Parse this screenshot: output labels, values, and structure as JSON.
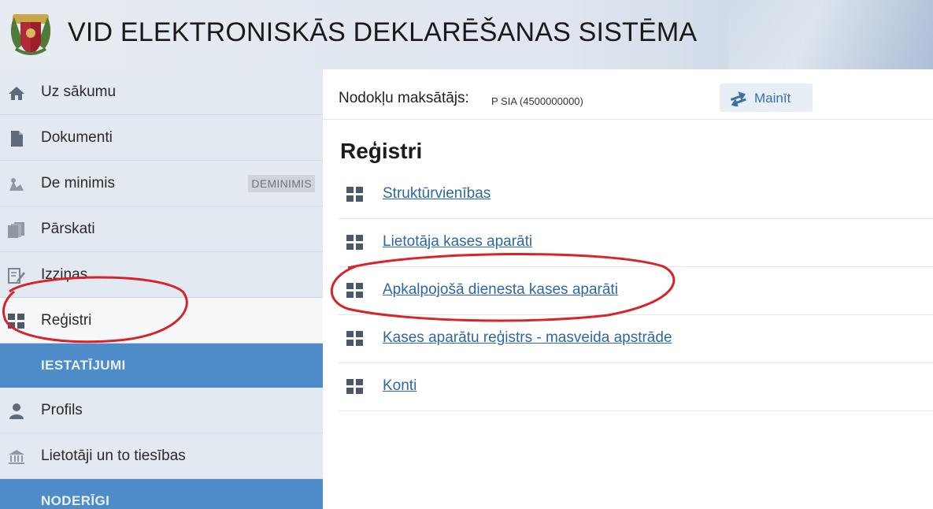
{
  "header": {
    "title": "VID ELEKTRONISKĀS DEKLARĒŠANAS SISTĒMA",
    "logo_icon": "coat-of-arms-icon"
  },
  "sidebar": {
    "items": [
      {
        "label": "Uz sākumu",
        "icon": "home-icon"
      },
      {
        "label": "Dokumenti",
        "icon": "document-icon"
      },
      {
        "label": "De minimis",
        "icon": "scale-icon",
        "badge": "DEMINIMIS"
      },
      {
        "label": "Pārskati",
        "icon": "reports-icon"
      },
      {
        "label": "Izziņas",
        "icon": "edit-doc-icon"
      },
      {
        "label": "Reģistri",
        "icon": "grid-icon",
        "active": true
      }
    ],
    "section_settings": "IESTATĪJUMI",
    "settings_items": [
      {
        "label": "Profils",
        "icon": "user-icon"
      },
      {
        "label": "Lietotāji un to tiesības",
        "icon": "users-icon"
      }
    ],
    "section_useful": "NODERĪGI"
  },
  "main": {
    "payer_label": "Nodokļu maksātājs:",
    "payer_value": "P SIA (4500000000)",
    "change_button": "Mainīt",
    "title": "Reģistri",
    "registers": [
      {
        "label": "Struktūrvienības"
      },
      {
        "label": "Lietotāja kases aparāti"
      },
      {
        "label": "Apkalpojošā dienesta kases aparāti"
      },
      {
        "label": "Kases aparātu reģistrs - masveida apstrāde"
      },
      {
        "label": "Konti"
      }
    ]
  },
  "colors": {
    "sidebar_bg": "#e2e9f1",
    "section_bg": "#4d8bc9",
    "link": "#2f67a6",
    "highlight_ellipse": "#d8232a"
  }
}
